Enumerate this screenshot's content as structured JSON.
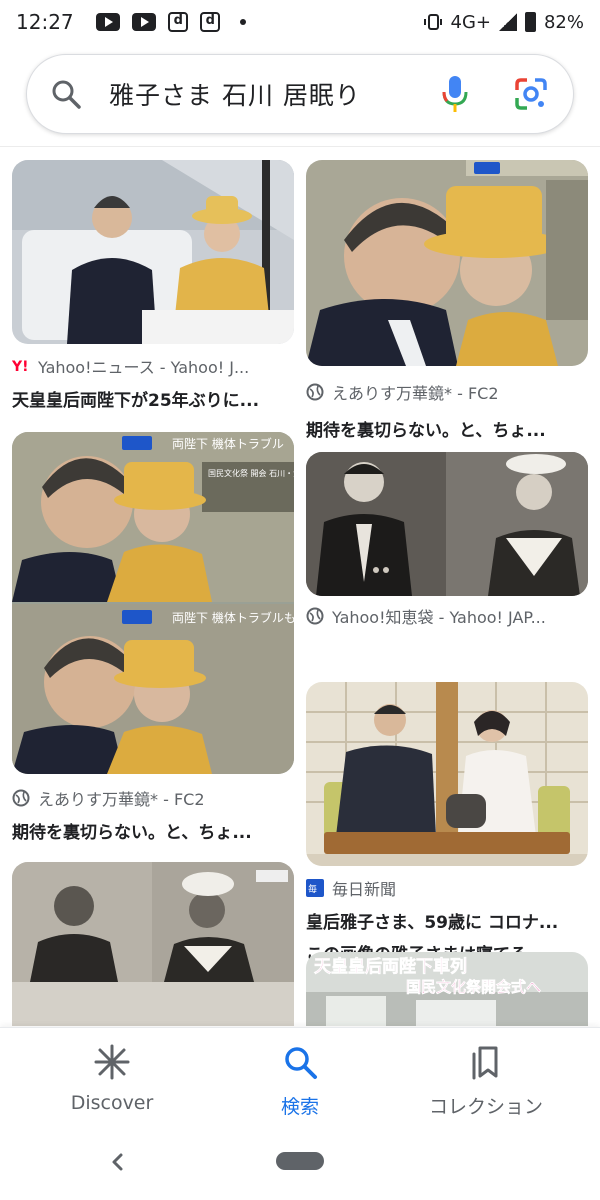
{
  "status_bar": {
    "time": "12:27",
    "network": "4G+",
    "battery": "82%"
  },
  "search": {
    "query": "雅子さま 石川 居眠り"
  },
  "results": [
    {
      "source": "Yahoo!ニュース - Yahoo! J...",
      "title": "天皇皇后両陛下が25年ぶりに..."
    },
    {
      "source": "えありす万華鏡* - FC2",
      "title": "期待を裏切らない。と、ちょ..."
    },
    {
      "source": "Yahoo!知恵袋 - Yahoo! JAP...",
      "title": "この画像の雅子さまは寝てる..."
    },
    {
      "source": "えありす万華鏡* - FC2",
      "title": "期待を裏切らない。と、ちょ..."
    },
    {
      "source": "毎日新聞",
      "title": "皇后雅子さま、59歳に コロナ..."
    }
  ],
  "image_captions": {
    "banner_a": "両陛下 機体トラブル",
    "banner_b": "両陛下 機体トラブルも",
    "banner_c": "国民文化祭 開会 石川・金沢市",
    "newspaper_headline": "天皇皇后両陛下車列",
    "newspaper_sub": "国民文化祭開会式へ"
  },
  "bottom_nav": {
    "discover": "Discover",
    "search": "検索",
    "collections": "コレクション"
  }
}
